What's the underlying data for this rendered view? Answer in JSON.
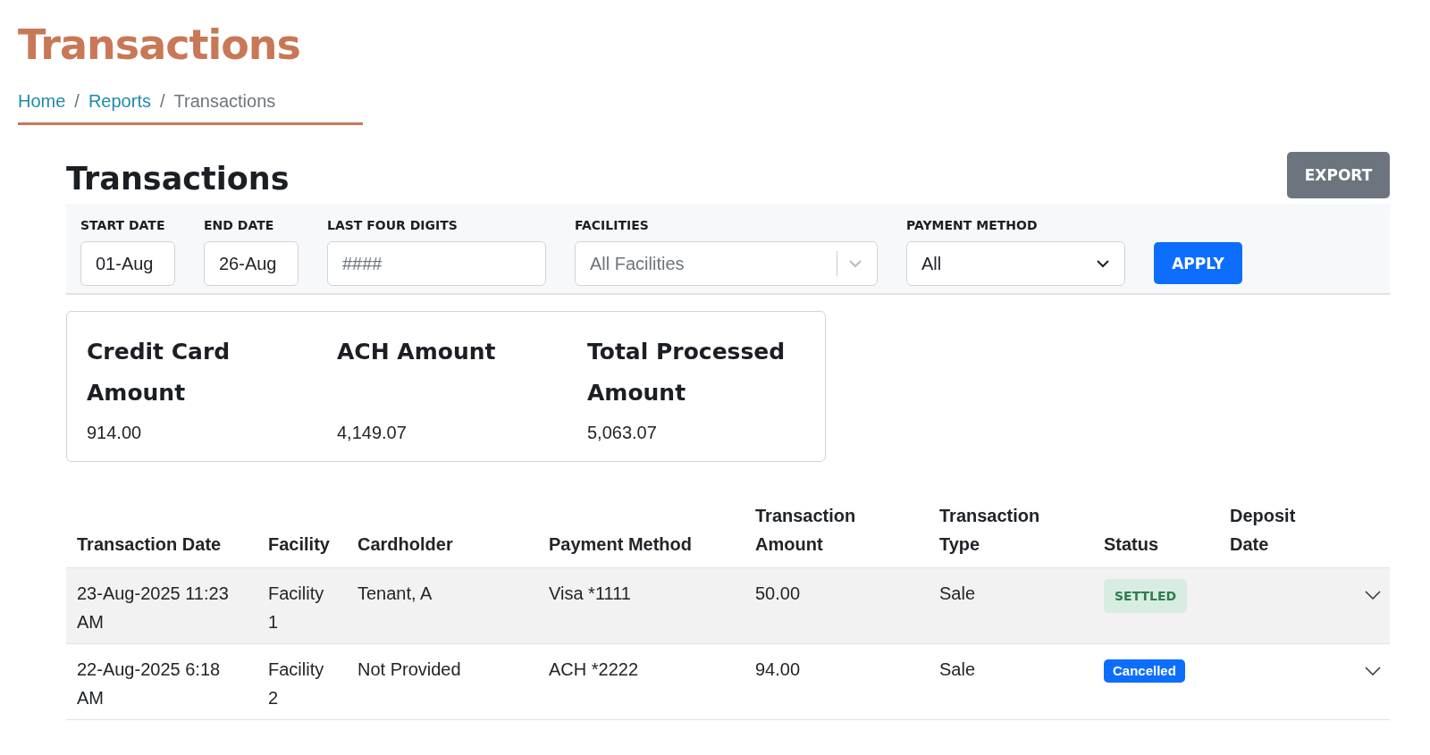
{
  "page_title": "Transactions",
  "breadcrumb": [
    {
      "label": "Home",
      "link": true
    },
    {
      "label": "Reports",
      "link": true
    },
    {
      "label": "Transactions",
      "link": false
    }
  ],
  "breadcrumb_separator": "/",
  "section_title": "Transactions",
  "export_button": "EXPORT",
  "filters": {
    "start_date": {
      "label": "START DATE",
      "value": "01-Aug"
    },
    "end_date": {
      "label": "END DATE",
      "value": "26-Aug"
    },
    "last_four": {
      "label": "LAST FOUR DIGITS",
      "placeholder": "####"
    },
    "facilities": {
      "label": "FACILITIES",
      "placeholder": "All Facilities"
    },
    "payment_method": {
      "label": "PAYMENT METHOD",
      "value": "All"
    },
    "apply_button": "APPLY"
  },
  "summary": [
    {
      "label": "Credit Card Amount",
      "value": "914.00"
    },
    {
      "label": "ACH Amount",
      "value": "4,149.07"
    },
    {
      "label": "Total Processed Amount",
      "value": "5,063.07"
    }
  ],
  "table": {
    "columns": [
      "Transaction Date",
      "Facility",
      "Cardholder",
      "Payment Method",
      "Transaction Amount",
      "Transaction Type",
      "Status",
      "Deposit Date"
    ],
    "rows": [
      {
        "date": "23-Aug-2025 11:23 AM",
        "facility": "Facility 1",
        "cardholder": "Tenant, A",
        "payment_method": "Visa *1111",
        "amount": "50.00",
        "type": "Sale",
        "status": {
          "label": "SETTLED",
          "kind": "settled"
        },
        "highlighted": true
      },
      {
        "date": "22-Aug-2025 6:18 AM",
        "facility": "Facility 2",
        "cardholder": "Not Provided",
        "payment_method": "ACH *2222",
        "amount": "94.00",
        "type": "Sale",
        "status": {
          "label": "Cancelled",
          "kind": "cancelled"
        },
        "highlighted": false
      }
    ]
  }
}
